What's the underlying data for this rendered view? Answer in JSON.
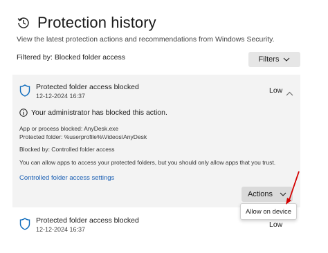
{
  "header": {
    "title": "Protection history",
    "icon": "history-icon"
  },
  "subtitle": "View the latest protection actions and recommendations from Windows Security.",
  "filter": {
    "label": "Filtered by: Blocked folder access",
    "button_label": "Filters"
  },
  "items": [
    {
      "title": "Protected folder access blocked",
      "date": "12-12-2024 16:37",
      "severity": "Low",
      "expanded": true,
      "admin_notice": "Your administrator has blocked this action.",
      "details": [
        "App or process blocked:  AnyDesk.exe",
        "Protected folder:  %userprofile%\\Videos\\AnyDesk",
        "Blocked by:  Controlled folder access",
        "You can allow apps to access your protected folders, but you should only allow apps that you trust."
      ],
      "link": "Controlled folder access settings",
      "actions_label": "Actions",
      "menu_items": [
        "Allow on device"
      ]
    },
    {
      "title": "Protected folder access blocked",
      "date": "12-12-2024 16:37",
      "severity": "Low",
      "expanded": false
    }
  ],
  "colors": {
    "accent": "#1a5fb4",
    "shield": "#0f6cbd",
    "annotation_arrow": "#d40000",
    "card_bg": "#f3f3f3"
  }
}
